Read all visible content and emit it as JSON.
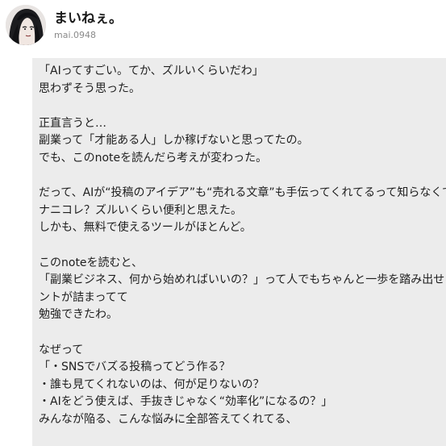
{
  "author": {
    "name": "まいねぇ。",
    "id": "mai.0948",
    "avatar_icon": "user-avatar-icon"
  },
  "article": {
    "lines": [
      "「AIってすごい。てか、ズルいくらいだわ」",
      "思わずそう思った。",
      "",
      "正直言うと…",
      "副業って「才能ある人」しか稼げないと思ってたの。",
      "でも、このnoteを読んだら考えが変わった。",
      "",
      "だって、AIが“投稿のアイデア”も“売れる文章”も手伝ってくれてるって知らなくて。",
      "ナニコレ？ズルいくらい便利と思えた。",
      "しかも、無料で使えるツールがほとんど。",
      "",
      "このnoteを読むと、",
      "「副業ビジネス、何から始めればいいの？」って人でもちゃんと一歩を踏み出せるヒ",
      "ントが詰まってて",
      "勉強できたわ。",
      "",
      "なぜって",
      "「・SNSでバズる投稿ってどう作る？",
      "・誰も見てくれないのは、何が足りないの？",
      "・AIをどう使えば、手抜きじゃなく“効率化”になるの？」",
      "みんなが陥る、こんな悩みに全部答えてくれてる、"
    ]
  },
  "colors": {
    "content_background": "#ececec",
    "page_background": "#ffffff",
    "text": "#1e1e1e",
    "muted": "#8a8a8a"
  }
}
